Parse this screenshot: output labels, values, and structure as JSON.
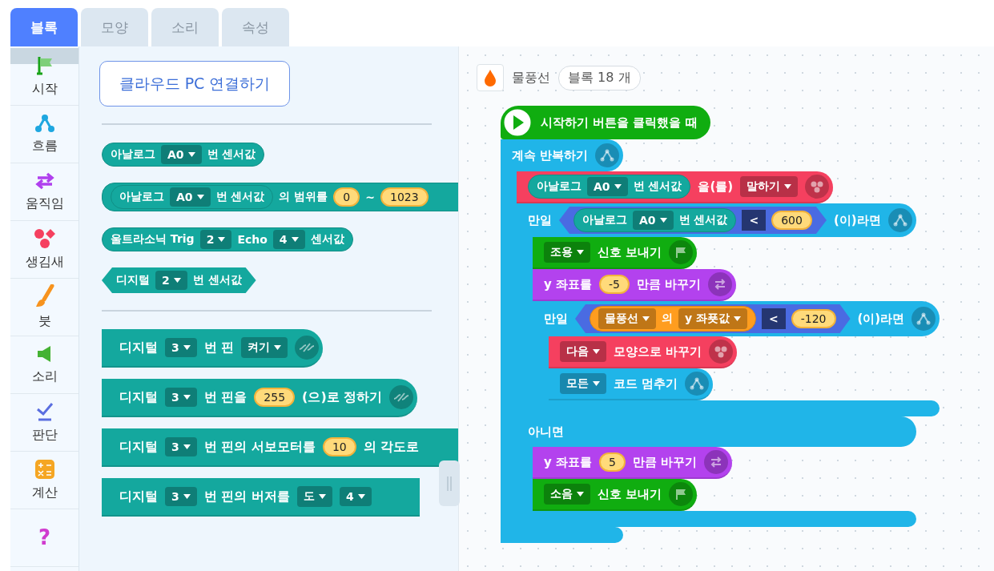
{
  "tabs": [
    {
      "label": "블록",
      "selected": true
    },
    {
      "label": "모양",
      "selected": false
    },
    {
      "label": "소리",
      "selected": false
    },
    {
      "label": "속성",
      "selected": false
    }
  ],
  "categories": [
    {
      "kind": "start",
      "label": "시작",
      "selected": true
    },
    {
      "kind": "flow",
      "label": "흐름",
      "selected": false
    },
    {
      "kind": "moving",
      "label": "움직임",
      "selected": false
    },
    {
      "kind": "looks",
      "label": "생김새",
      "selected": false
    },
    {
      "kind": "brush",
      "label": "붓",
      "selected": false
    },
    {
      "kind": "sound",
      "label": "소리",
      "selected": false
    },
    {
      "kind": "judge",
      "label": "판단",
      "selected": false
    },
    {
      "kind": "calc",
      "label": "계산",
      "selected": false
    },
    {
      "kind": "help",
      "glyph": "?",
      "selected": false
    }
  ],
  "palette": {
    "button": "클라우드 PC 연결하기",
    "sections": [
      [
        {
          "kind": "reporter",
          "color": "#14a89e",
          "parts": [
            {
              "kind": "text",
              "text": "아날로그"
            },
            {
              "kind": "dropdown",
              "text": "A0"
            },
            {
              "kind": "text",
              "text": "번 센서값"
            }
          ]
        },
        {
          "kind": "reporter",
          "color": "#14a89e",
          "cut": true,
          "parts": [
            {
              "kind": "block",
              "block": {
                "kind": "reporter",
                "color": "#14a89e",
                "parts": [
                  {
                    "kind": "text",
                    "text": "아날로그"
                  },
                  {
                    "kind": "dropdown",
                    "text": "A0"
                  },
                  {
                    "kind": "text",
                    "text": "번 센서값"
                  }
                ]
              }
            },
            {
              "kind": "text",
              "text": "의 범위를"
            },
            {
              "kind": "number",
              "text": "0"
            },
            {
              "kind": "text",
              "text": "~"
            },
            {
              "kind": "number",
              "text": "1023"
            }
          ]
        },
        {
          "kind": "reporter",
          "color": "#14a89e",
          "parts": [
            {
              "kind": "text",
              "text": "울트라소닉 Trig"
            },
            {
              "kind": "dropdown",
              "text": "2"
            },
            {
              "kind": "text",
              "text": "Echo"
            },
            {
              "kind": "dropdown",
              "text": "4"
            },
            {
              "kind": "text",
              "text": "센서값"
            }
          ]
        },
        {
          "kind": "boolean",
          "color": "#14a89e",
          "parts": [
            {
              "kind": "text",
              "text": "디지털"
            },
            {
              "kind": "dropdown",
              "text": "2"
            },
            {
              "kind": "text",
              "text": "번 센서값"
            }
          ]
        }
      ],
      [
        {
          "kind": "statement",
          "color": "#14a89e",
          "parts": [
            {
              "kind": "text",
              "text": "디지털"
            },
            {
              "kind": "dropdown",
              "text": "3"
            },
            {
              "kind": "text",
              "text": "번 핀"
            },
            {
              "kind": "dropdown",
              "text": "켜기"
            },
            {
              "kind": "wave"
            }
          ]
        },
        {
          "kind": "statement",
          "color": "#14a89e",
          "parts": [
            {
              "kind": "text",
              "text": "디지털"
            },
            {
              "kind": "dropdown",
              "text": "3"
            },
            {
              "kind": "text",
              "text": "번 핀을"
            },
            {
              "kind": "number",
              "text": "255"
            },
            {
              "kind": "text",
              "text": "(으)로 정하기"
            },
            {
              "kind": "wave"
            }
          ]
        },
        {
          "kind": "statement",
          "color": "#14a89e",
          "cut": true,
          "parts": [
            {
              "kind": "text",
              "text": "디지털"
            },
            {
              "kind": "dropdown",
              "text": "3"
            },
            {
              "kind": "text",
              "text": "번 핀의 서보모터를"
            },
            {
              "kind": "number",
              "text": "10"
            },
            {
              "kind": "text",
              "text": "의 각도로"
            }
          ]
        },
        {
          "kind": "statement",
          "color": "#14a89e",
          "cut": true,
          "parts": [
            {
              "kind": "text",
              "text": "디지털"
            },
            {
              "kind": "dropdown",
              "text": "3"
            },
            {
              "kind": "text",
              "text": "번 핀의 버저를"
            },
            {
              "kind": "dropdown",
              "text": "도"
            },
            {
              "kind": "dropdown",
              "text": "4"
            }
          ]
        }
      ]
    ]
  },
  "sprite": {
    "name": "물풍선",
    "block_count": "블록 18 개"
  },
  "script": [
    {
      "kind": "hat",
      "color": "#10ad10",
      "parts": [
        {
          "kind": "play"
        },
        {
          "kind": "text",
          "text": "시작하기 버튼을 클릭했을 때"
        }
      ]
    },
    {
      "kind": "c",
      "color": "#20b5e8",
      "parts": [
        {
          "kind": "text",
          "text": "계속 반복하기"
        },
        {
          "kind": "nodes"
        }
      ],
      "body": [
        {
          "kind": "statement",
          "color": "#f5405f",
          "parts": [
            {
              "kind": "block",
              "block": {
                "kind": "reporter",
                "color": "#14a89e",
                "parts": [
                  {
                    "kind": "text",
                    "text": "아날로그"
                  },
                  {
                    "kind": "dropdown",
                    "text": "A0"
                  },
                  {
                    "kind": "text",
                    "text": "번 센서값"
                  }
                ]
              }
            },
            {
              "kind": "text",
              "text": "을(를)"
            },
            {
              "kind": "dropdown",
              "text": "말하기"
            },
            {
              "kind": "dots"
            }
          ]
        },
        {
          "kind": "c",
          "color": "#20b5e8",
          "parts": [
            {
              "kind": "text",
              "text": "만일"
            },
            {
              "kind": "block",
              "block": {
                "kind": "boolean",
                "color": "#4a6be2",
                "parts": [
                  {
                    "kind": "block",
                    "block": {
                      "kind": "reporter",
                      "color": "#14a89e",
                      "parts": [
                        {
                          "kind": "text",
                          "text": "아날로그"
                        },
                        {
                          "kind": "dropdown",
                          "text": "A0"
                        },
                        {
                          "kind": "text",
                          "text": "번 센서값"
                        }
                      ]
                    }
                  },
                  {
                    "kind": "op",
                    "text": "<"
                  },
                  {
                    "kind": "number",
                    "text": "600"
                  }
                ]
              }
            },
            {
              "kind": "text",
              "text": "(이)라면"
            },
            {
              "kind": "nodes"
            }
          ],
          "body": [
            {
              "kind": "statement",
              "color": "#10ad10",
              "parts": [
                {
                  "kind": "dropdown",
                  "text": "조용"
                },
                {
                  "kind": "text",
                  "text": "신호 보내기"
                },
                {
                  "kind": "flag"
                }
              ]
            },
            {
              "kind": "statement",
              "color": "#b342ee",
              "parts": [
                {
                  "kind": "text",
                  "text": "y 좌표를"
                },
                {
                  "kind": "number",
                  "text": "-5"
                },
                {
                  "kind": "text",
                  "text": "만큼 바꾸기"
                },
                {
                  "kind": "arrows"
                }
              ]
            },
            {
              "kind": "c",
              "color": "#20b5e8",
              "parts": [
                {
                  "kind": "text",
                  "text": "만일"
                },
                {
                  "kind": "block",
                  "block": {
                    "kind": "boolean",
                    "color": "#4a6be2",
                    "parts": [
                      {
                        "kind": "block",
                        "block": {
                          "kind": "reporter",
                          "color": "#ff9d1f",
                          "parts": [
                            {
                              "kind": "dropdown",
                              "text": "물풍선"
                            },
                            {
                              "kind": "text",
                              "text": "의"
                            },
                            {
                              "kind": "dropdown",
                              "text": "y 좌푯값"
                            }
                          ]
                        }
                      },
                      {
                        "kind": "op",
                        "text": "<"
                      },
                      {
                        "kind": "number",
                        "text": "-120"
                      }
                    ]
                  }
                },
                {
                  "kind": "text",
                  "text": "(이)라면"
                },
                {
                  "kind": "nodes"
                }
              ],
              "body": [
                {
                  "kind": "statement",
                  "color": "#f5405f",
                  "parts": [
                    {
                      "kind": "dropdown",
                      "text": "다음"
                    },
                    {
                      "kind": "text",
                      "text": "모양으로 바꾸기"
                    },
                    {
                      "kind": "dots"
                    }
                  ]
                },
                {
                  "kind": "statement",
                  "color": "#20b5e8",
                  "parts": [
                    {
                      "kind": "dropdown",
                      "text": "모든"
                    },
                    {
                      "kind": "text",
                      "text": "코드 멈추기"
                    },
                    {
                      "kind": "nodes"
                    }
                  ]
                }
              ]
            }
          ],
          "else_parts": [
            {
              "kind": "text",
              "text": "아니면"
            }
          ],
          "else_body": [
            {
              "kind": "statement",
              "color": "#b342ee",
              "parts": [
                {
                  "kind": "text",
                  "text": "y 좌표를"
                },
                {
                  "kind": "number",
                  "text": "5"
                },
                {
                  "kind": "text",
                  "text": "만큼 바꾸기"
                },
                {
                  "kind": "arrows"
                }
              ]
            },
            {
              "kind": "statement",
              "color": "#10ad10",
              "parts": [
                {
                  "kind": "dropdown",
                  "text": "소음"
                },
                {
                  "kind": "text",
                  "text": "신호 보내기"
                },
                {
                  "kind": "flag"
                }
              ]
            }
          ]
        }
      ]
    }
  ]
}
